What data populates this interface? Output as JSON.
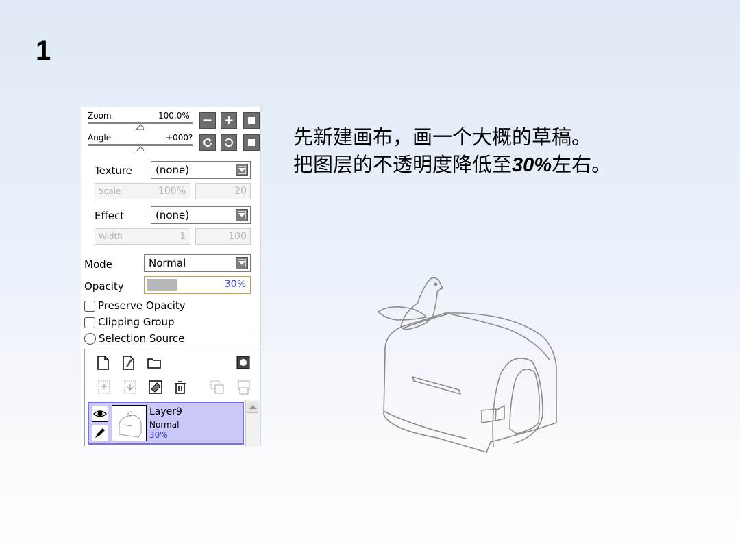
{
  "slide": {
    "number": "1",
    "line1": "先新建画布，画一个大概的草稿。",
    "line2_pre": "把图层的不透明度降低至",
    "line2_num": "30%",
    "line2_post": "左右。"
  },
  "panel": {
    "zoom": {
      "label": "Zoom",
      "value": "100.0%"
    },
    "angle": {
      "label": "Angle",
      "value": "+000?"
    },
    "texture": {
      "label": "Texture",
      "value": "(none)"
    },
    "scale": {
      "label": "Scale",
      "value": "100%",
      "amount": "20"
    },
    "effect": {
      "label": "Effect",
      "value": "(none)"
    },
    "width": {
      "label": "Width",
      "value": "1",
      "amount": "100"
    },
    "mode": {
      "label": "Mode",
      "value": "Normal"
    },
    "opacity": {
      "label": "Opacity",
      "value": "30%",
      "fraction": 0.3
    },
    "checks": {
      "preserve": "Preserve Opacity",
      "clipping": "Clipping Group",
      "selection": "Selection Source"
    },
    "layer": {
      "name": "Layer9",
      "mode": "Normal",
      "opacity": "30%"
    }
  },
  "colors": {
    "accent_orange": "#e0943e",
    "layer_selected": "#c9c8f8",
    "layer_border": "#7a6fe6"
  }
}
